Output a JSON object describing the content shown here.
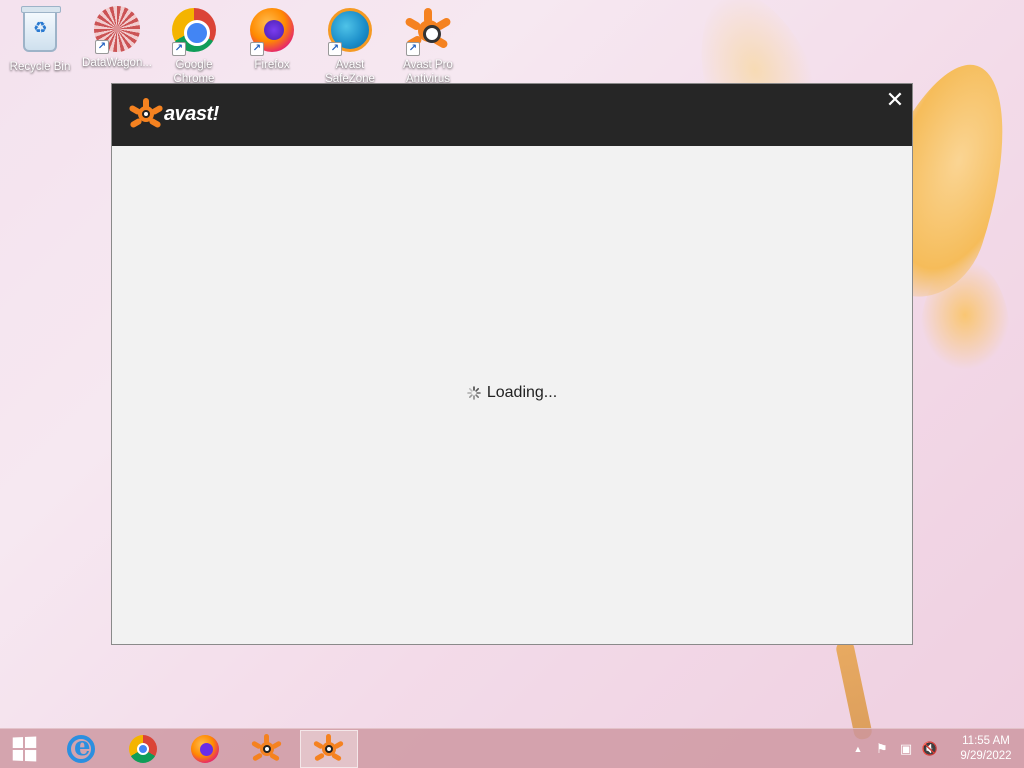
{
  "desktop": {
    "icons": [
      {
        "label": "Recycle Bin",
        "icon": "recycle-bin-icon"
      },
      {
        "label": "DataWagon...",
        "icon": "datawagon-icon"
      },
      {
        "label": "Google Chrome",
        "icon": "chrome-icon"
      },
      {
        "label": "Firefox",
        "icon": "firefox-icon"
      },
      {
        "label": "Avast SafeZone",
        "icon": "avast-safezone-icon"
      },
      {
        "label": "Avast Pro Antivirus",
        "icon": "avast-icon"
      }
    ]
  },
  "dialog": {
    "brand": "avast!",
    "close_glyph": "✕",
    "loading_text": "Loading...",
    "accent_color": "#f58220",
    "header_color": "#262626"
  },
  "taskbar": {
    "items": [
      {
        "icon": "windows-start-icon"
      },
      {
        "icon": "internet-explorer-icon"
      },
      {
        "icon": "chrome-icon"
      },
      {
        "icon": "firefox-icon"
      },
      {
        "icon": "avast-icon"
      },
      {
        "icon": "avast-icon",
        "active": true
      }
    ],
    "tray": {
      "chevron": "▲",
      "flag": "⚑",
      "network": "▣",
      "volume": "🔇"
    },
    "clock": {
      "time": "11:55 AM",
      "date": "9/29/2022"
    }
  }
}
